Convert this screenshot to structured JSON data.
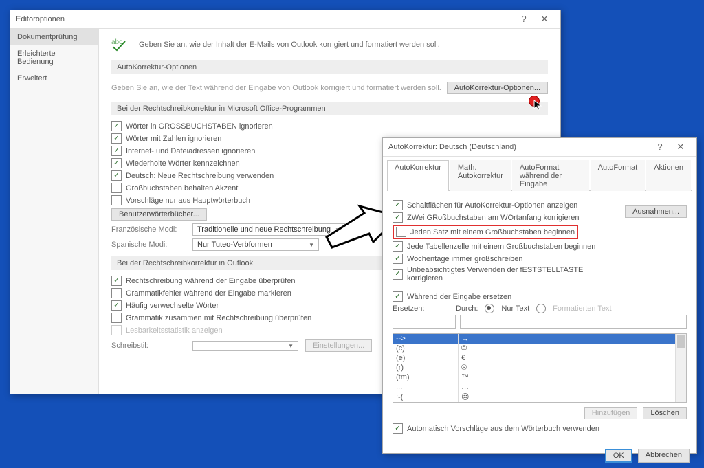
{
  "editor": {
    "title": "Editoroptionen",
    "side": {
      "items": [
        "Dokumentprüfung",
        "Erleichterte Bedienung",
        "Erweitert"
      ],
      "selected": 0
    },
    "intro": "Geben Sie an, wie der Inhalt der E-Mails von Outlook korrigiert und formatiert werden soll.",
    "autocorrect_section": "AutoKorrektur-Optionen",
    "autocorrect_desc": "Geben Sie an, wie der Text während der Eingabe von Outlook korrigiert und formatiert werden soll.",
    "autocorrect_btn": "AutoKorrektur-Optionen...",
    "spell_section": "Bei der Rechtschreibkorrektur in Microsoft Office-Programmen",
    "spell_opts": [
      {
        "label": "Wörter in GROSSBUCHSTABEN ignorieren",
        "checked": true
      },
      {
        "label": "Wörter mit Zahlen ignorieren",
        "checked": true
      },
      {
        "label": "Internet- und Dateiadressen ignorieren",
        "checked": true
      },
      {
        "label": "Wiederholte Wörter kennzeichnen",
        "checked": true
      },
      {
        "label": "Deutsch: Neue Rechtschreibung verwenden",
        "checked": true
      },
      {
        "label": "Großbuchstaben behalten Akzent",
        "checked": false
      },
      {
        "label": "Vorschläge nur aus Hauptwörterbuch",
        "checked": false
      }
    ],
    "userdict_btn": "Benutzerwörterbücher...",
    "fr_label": "Französische Modi:",
    "fr_value": "Traditionelle und neue Rechtschreibung",
    "es_label": "Spanische Modi:",
    "es_value": "Nur Tuteo-Verbformen",
    "outlook_section": "Bei der Rechtschreibkorrektur in Outlook",
    "outlook_opts": [
      {
        "label": "Rechtschreibung während der Eingabe überprüfen",
        "checked": true
      },
      {
        "label": "Grammatikfehler während der Eingabe markieren",
        "checked": false
      },
      {
        "label": "Häufig verwechselte Wörter",
        "checked": true
      },
      {
        "label": "Grammatik zusammen mit Rechtschreibung überprüfen",
        "checked": false
      },
      {
        "label": "Lesbarkeitsstatistik anzeigen",
        "checked": false,
        "disabled": true
      }
    ],
    "style_label": "Schreibstil:",
    "style_value": "",
    "settings_btn": "Einstellungen..."
  },
  "ak": {
    "title": "AutoKorrektur: Deutsch (Deutschland)",
    "tabs": [
      "AutoKorrektur",
      "Math. Autokorrektur",
      "AutoFormat während der Eingabe",
      "AutoFormat",
      "Aktionen"
    ],
    "tab_selected": 0,
    "opts": [
      {
        "label": "Schaltflächen für AutoKorrektur-Optionen anzeigen",
        "checked": true
      },
      {
        "label": "ZWei GRoßbuchstaben am WOrtanfang korrigieren",
        "checked": true
      },
      {
        "label": "Jeden Satz mit einem Großbuchstaben beginnen",
        "checked": false,
        "highlight": true
      },
      {
        "label": "Jede Tabellenzelle mit einem Großbuchstaben beginnen",
        "checked": true
      },
      {
        "label": "Wochentage immer großschreiben",
        "checked": true
      },
      {
        "label": "Unbeabsichtigtes Verwenden der fESTSTELLTASTE korrigieren",
        "checked": true
      }
    ],
    "exceptions_btn": "Ausnahmen...",
    "replace_check": {
      "label": "Während der Eingabe ersetzen",
      "checked": true
    },
    "replace_label": "Ersetzen:",
    "with_label": "Durch:",
    "rad_plain": "Nur Text",
    "rad_formatted": "Formatierten Text",
    "rows": [
      {
        "a": "-->",
        "b": "→",
        "sel": true
      },
      {
        "a": "(c)",
        "b": "©"
      },
      {
        "a": "(e)",
        "b": "€"
      },
      {
        "a": "(r)",
        "b": "®"
      },
      {
        "a": "(tm)",
        "b": "™"
      },
      {
        "a": "...",
        "b": "…"
      },
      {
        "a": ":-(",
        "b": "☹"
      }
    ],
    "add_btn": "Hinzufügen",
    "del_btn": "Löschen",
    "auto_dict": {
      "label": "Automatisch Vorschläge aus dem Wörterbuch verwenden",
      "checked": true
    },
    "ok": "OK",
    "cancel": "Abbrechen"
  }
}
